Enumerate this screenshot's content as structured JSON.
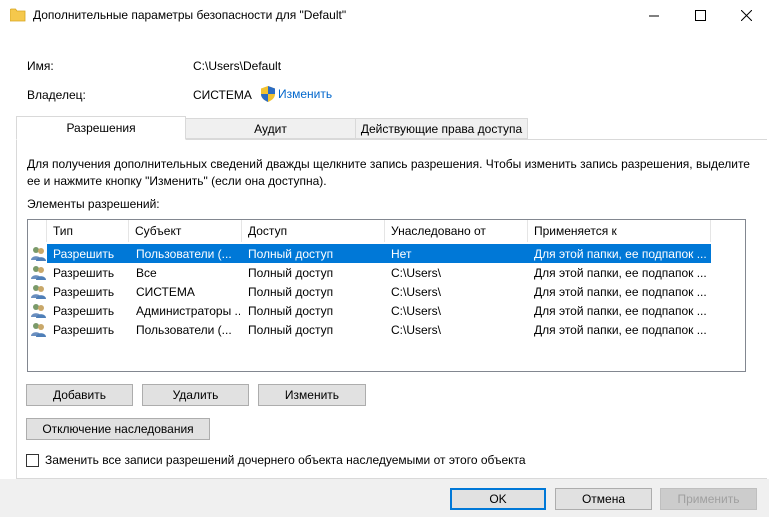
{
  "window": {
    "title": "Дополнительные параметры безопасности  для \"Default\"",
    "icon": "folder-icon",
    "controls": [
      "minimize",
      "maximize",
      "close"
    ]
  },
  "info_fields": {
    "name_label": "Имя:",
    "name_value": "C:\\Users\\Default",
    "owner_label": "Владелец:",
    "owner_value": "СИСТЕМА",
    "change_link": "Изменить"
  },
  "tabs": [
    {
      "label": "Разрешения",
      "active": true
    },
    {
      "label": "Аудит",
      "active": false
    },
    {
      "label": "Действующие права доступа",
      "active": false
    }
  ],
  "info_text": "Для получения дополнительных сведений дважды щелкните запись разрешения. Чтобы изменить запись разрешения, выделите ее и нажмите кнопку \"Изменить\" (если она доступна).",
  "list_label": "Элементы разрешений:",
  "table": {
    "columns": [
      "Тип",
      "Субъект",
      "Доступ",
      "Унаследовано от",
      "Применяется к"
    ],
    "rows": [
      {
        "type": "Разрешить",
        "subject": "Пользователи (...",
        "access": "Полный доступ",
        "inherited": "Нет",
        "applies": "Для этой папки, ее подпапок ...",
        "selected": true
      },
      {
        "type": "Разрешить",
        "subject": "Все",
        "access": "Полный доступ",
        "inherited": "C:\\Users\\",
        "applies": "Для этой папки, ее подпапок ...",
        "selected": false
      },
      {
        "type": "Разрешить",
        "subject": "СИСТЕМА",
        "access": "Полный доступ",
        "inherited": "C:\\Users\\",
        "applies": "Для этой папки, ее подпапок ...",
        "selected": false
      },
      {
        "type": "Разрешить",
        "subject": "Администраторы ...",
        "access": "Полный доступ",
        "inherited": "C:\\Users\\",
        "applies": "Для этой папки, ее подпапок ...",
        "selected": false
      },
      {
        "type": "Разрешить",
        "subject": "Пользователи (...",
        "access": "Полный доступ",
        "inherited": "C:\\Users\\",
        "applies": "Для этой папки, ее подпапок ...",
        "selected": false
      }
    ]
  },
  "buttons": {
    "add": "Добавить",
    "remove": "Удалить",
    "edit": "Изменить",
    "disable_inheritance": "Отключение наследования",
    "ok": "OK",
    "cancel": "Отмена",
    "apply": "Применить"
  },
  "checkbox": {
    "label": "Заменить все записи разрешений дочернего объекта наследуемыми от этого объекта",
    "checked": false
  },
  "colors": {
    "selection": "#0078d7",
    "link": "#0066cc"
  }
}
